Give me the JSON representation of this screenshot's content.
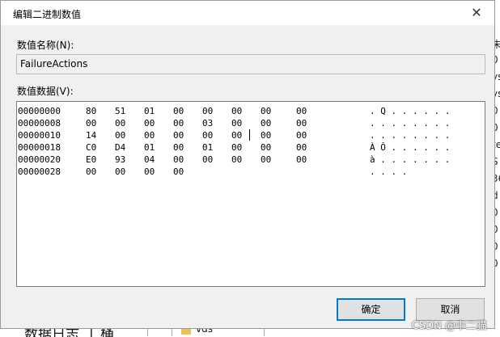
{
  "dialog": {
    "title": "编辑二进制数值",
    "close_glyph": "✕",
    "name_label": "数值名称(N):",
    "name_value": "FailureActions",
    "data_label": "数值数据(V):",
    "rows": [
      {
        "addr": "00000000",
        "bytes": [
          "80",
          "51",
          "01",
          "00",
          "00",
          "00",
          "00",
          "00"
        ],
        "ascii": ". Q . . . . . ."
      },
      {
        "addr": "00000008",
        "bytes": [
          "00",
          "00",
          "00",
          "00",
          "03",
          "00",
          "00",
          "00"
        ],
        "ascii": ". . . . . . . ."
      },
      {
        "addr": "00000010",
        "bytes": [
          "14",
          "00",
          "00",
          "00",
          "00",
          "00",
          "00",
          "00"
        ],
        "ascii": ". . . . . . . ."
      },
      {
        "addr": "00000018",
        "bytes": [
          "C0",
          "D4",
          "01",
          "00",
          "01",
          "00",
          "00",
          "00"
        ],
        "ascii": "À Ô . . . . . ."
      },
      {
        "addr": "00000020",
        "bytes": [
          "E0",
          "93",
          "04",
          "00",
          "00",
          "00",
          "00",
          "00"
        ],
        "ascii": "à . . . . . . ."
      },
      {
        "addr": "00000028",
        "bytes": [
          "00",
          "00",
          "00",
          "00"
        ],
        "ascii": ". . . ."
      }
    ],
    "ok_label": "确定",
    "cancel_label": "取消"
  },
  "background": {
    "right_fragments": [
      "未",
      "0",
      "ys",
      "ys",
      "0",
      "0",
      "te",
      "S",
      "36",
      "d",
      "0",
      "0",
      "0",
      "0"
    ],
    "bottom_fragments": [
      "数据日志",
      "|",
      "桶"
    ],
    "folder_label": "vds"
  },
  "watermark": "CSDN @中二猫",
  "colors": {
    "accent": "#0078d7",
    "folder": "#e8c35a"
  }
}
